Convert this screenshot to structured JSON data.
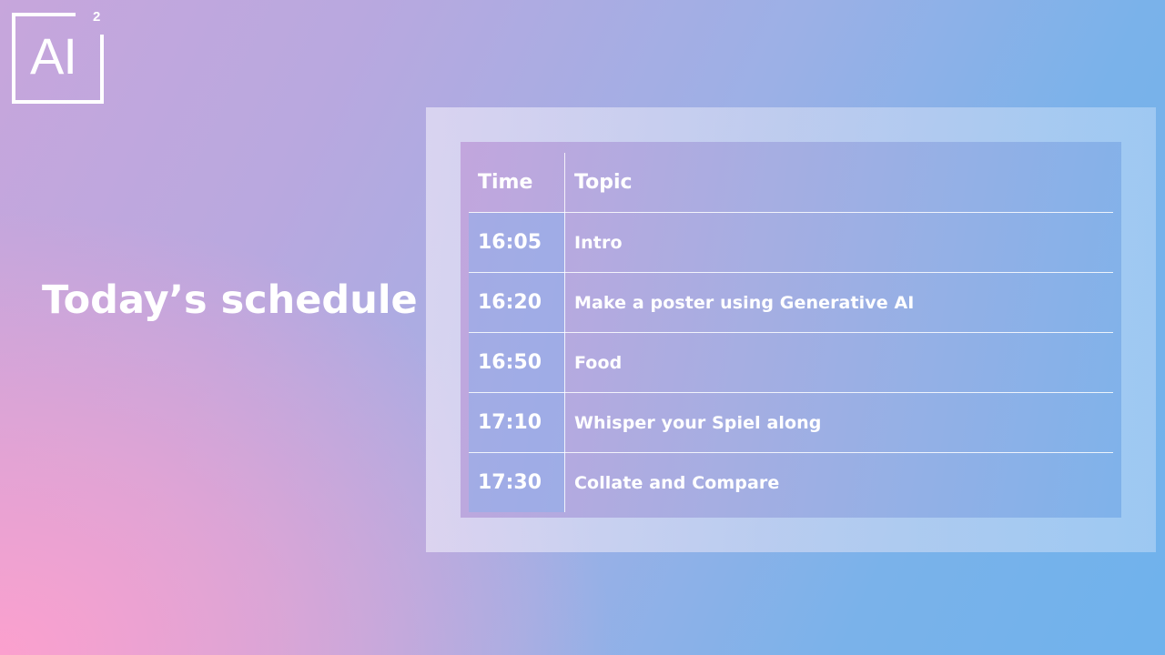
{
  "logo": {
    "text": "AI",
    "superscript": "2"
  },
  "title": "Today’s schedule",
  "table": {
    "headers": {
      "time": "Time",
      "topic": "Topic"
    },
    "rows": [
      {
        "time": "16:05",
        "topic": "Intro"
      },
      {
        "time": "16:20",
        "topic": "Make a poster using Generative AI"
      },
      {
        "time": "16:50",
        "topic": "Food"
      },
      {
        "time": "17:10",
        "topic": "Whisper your Spiel along"
      },
      {
        "time": "17:30",
        "topic": "Collate and Compare"
      }
    ]
  }
}
